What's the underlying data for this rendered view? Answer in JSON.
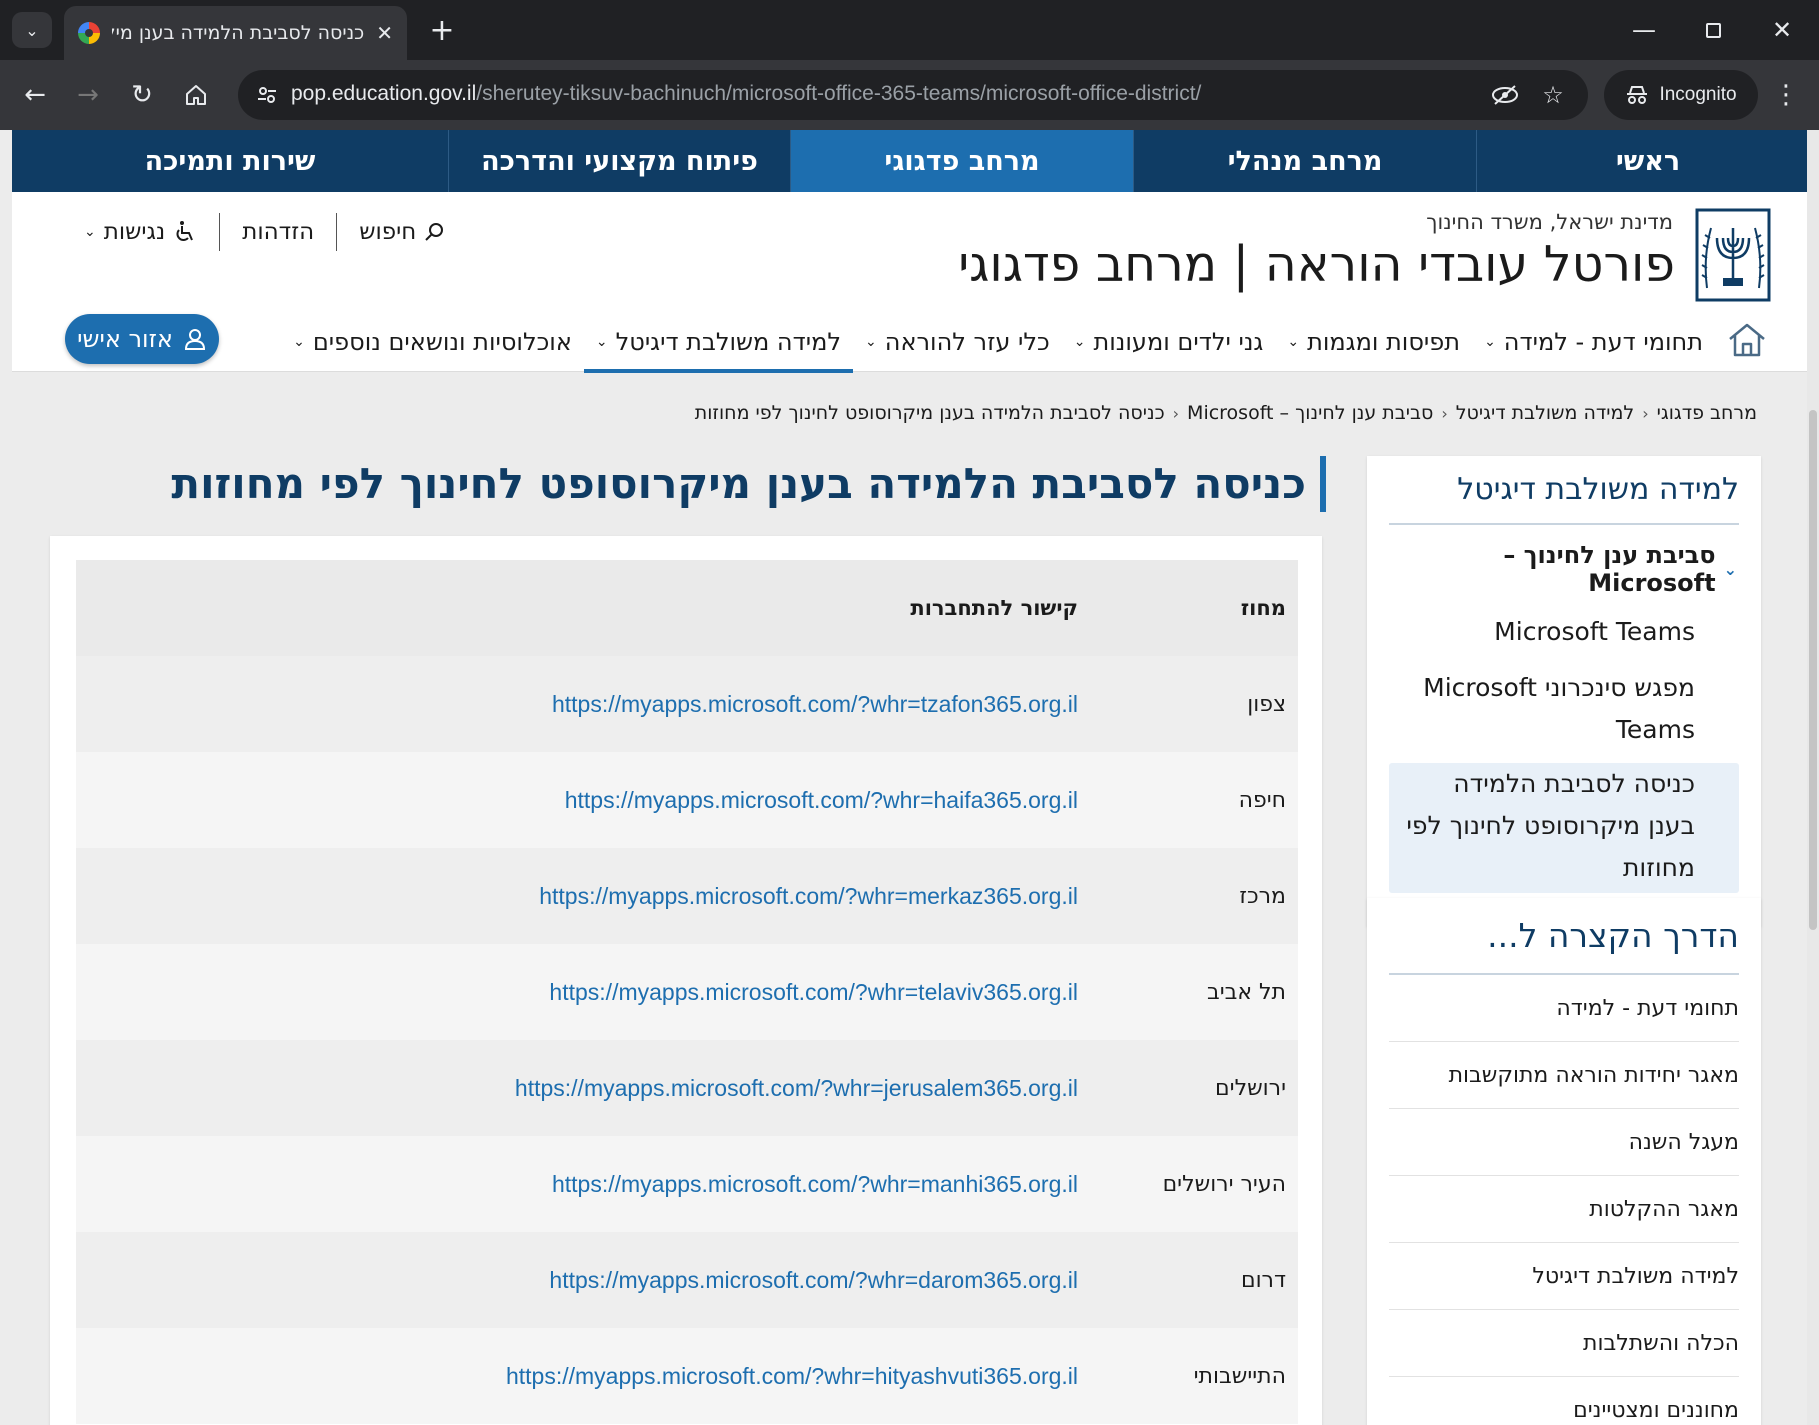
{
  "browser": {
    "tab_title": "כניסה לסביבת הלמידה בענן מיקרוסופט לחינוך לפי מחוזות",
    "url_host": "pop.education.gov.il",
    "url_path": "/sherutey-tiksuv-bachinuch/microsoft-office-365-teams/microsoft-office-district/",
    "incognito_label": "Incognito"
  },
  "top_nav": [
    "ראשי",
    "מרחב מנהלי",
    "מרחב פדגוגי",
    "פיתוח מקצועי והדרכה",
    "שירות ותמיכה"
  ],
  "header": {
    "gov_label": "מדינת ישראל, משרד החינוך",
    "portal_title": "פורטל עובדי הוראה | מרחב פדגוגי",
    "search_label": "חיפוש",
    "login_label": "הזדהות",
    "accessibility_label": "נגישות",
    "personal_area_label": "אזור אישי"
  },
  "main_nav": [
    "תחומי דעת - למידה",
    "תפיסות ומגמות",
    "גני ילדים ומעונות",
    "כלי עזר להוראה",
    "למידה משולבת דיגיטל",
    "אוכלוסיות ונושאים נוספים"
  ],
  "breadcrumb": [
    "מרחב פדגוגי",
    "למידה משולבת דיגיטל",
    "סביבת ענן לחינוך – Microsoft",
    "כניסה לסביבת הלמידה בענן מיקרוסופט לחינוך לפי מחוזות"
  ],
  "sidebar": {
    "title": "למידה משולבת דיגיטל",
    "sub_title": "סביבת ענן לחינוך – Microsoft",
    "links": [
      "Microsoft Teams",
      "מפגש סינכרוני Microsoft Teams",
      "כניסה לסביבת הלמידה בענן מיקרוסופט לחינוך לפי מחוזות"
    ]
  },
  "shortcuts": {
    "title": "הדרך הקצרה ל...",
    "items": [
      "תחומי דעת - למידה",
      "מאגר יחידות הוראה מתוקשבות",
      "מעגל השנה",
      "מאגר ההקלטות",
      "למידה משולבת דיגיטל",
      "הכלה והשתלבות",
      "מחוננים ומצטיינים"
    ]
  },
  "page": {
    "title": "כניסה לסביבת הלמידה בענן מיקרוסופט לחינוך לפי מחוזות"
  },
  "table": {
    "headers": {
      "district": "מחוז",
      "link": "קישור להתחברות"
    },
    "rows": [
      {
        "district": "צפון",
        "link": "https://myapps.microsoft.com/?whr=tzafon365.org.il"
      },
      {
        "district": "חיפה",
        "link": "https://myapps.microsoft.com/?whr=haifa365.org.il"
      },
      {
        "district": "מרכז",
        "link": "https://myapps.microsoft.com/?whr=merkaz365.org.il"
      },
      {
        "district": "תל אביב",
        "link": "https://myapps.microsoft.com/?whr=telaviv365.org.il"
      },
      {
        "district": "ירושלים",
        "link": "https://myapps.microsoft.com/?whr=jerusalem365.org.il"
      },
      {
        "district": "העיר ירושלים",
        "link": "https://myapps.microsoft.com/?whr=manhi365.org.il"
      },
      {
        "district": "דרום",
        "link": "https://myapps.microsoft.com/?whr=darom365.org.il"
      },
      {
        "district": "התיישבותי",
        "link": "https://myapps.microsoft.com/?whr=hityashvuti365.org.il"
      }
    ]
  },
  "colors": {
    "nav_dark": "#0f3c64",
    "accent": "#1d6eaf",
    "link": "#1d6eaf"
  }
}
